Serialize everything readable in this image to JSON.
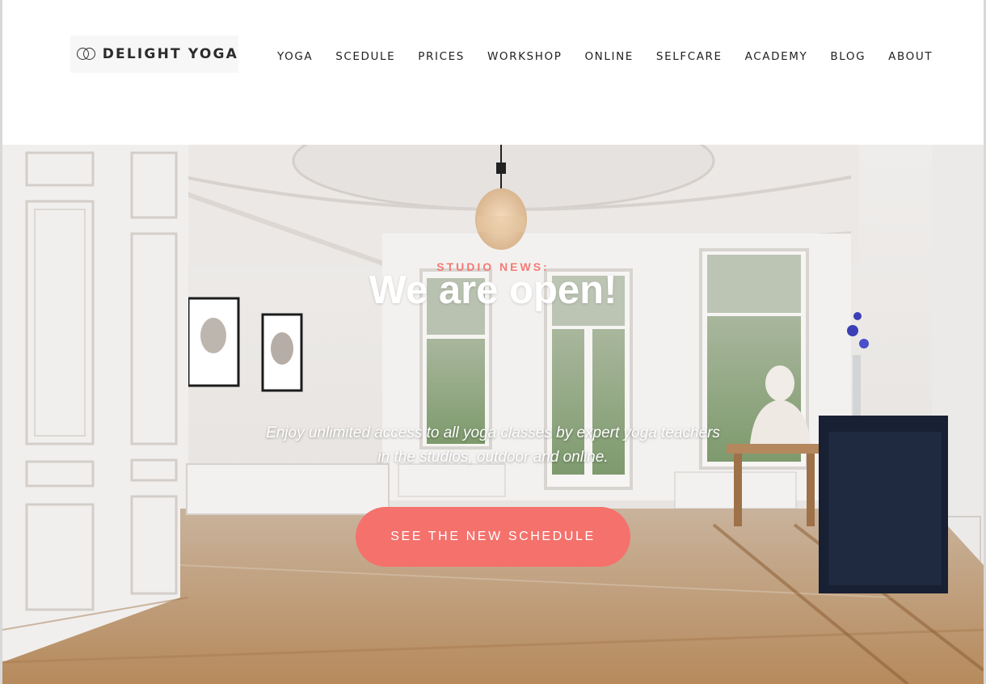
{
  "brand": {
    "name": "DELIGHT YOGA",
    "logo_icon": "double-ring-icon"
  },
  "nav": {
    "items": [
      "YOGA",
      "SCEDULE",
      "PRICES",
      "WORKSHOP",
      "ONLINE",
      "SELFCARE",
      "ACADEMY",
      "BLOG",
      "ABOUT"
    ]
  },
  "hero": {
    "kicker": "STUDIO NEWS:",
    "title": "We are open!",
    "subtitle_line1": "Enjoy unlimited access to all yoga classes by expert yoga teachers",
    "subtitle_line2": "in the studios, outdoor and online.",
    "cta_label": "SEE THE NEW SCHEDULE"
  },
  "colors": {
    "accent": "#f4716c",
    "text": "#222222",
    "background": "#ffffff"
  }
}
